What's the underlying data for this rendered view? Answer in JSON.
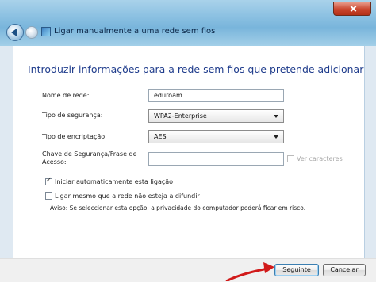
{
  "window": {
    "title": "Ligar manualmente a uma rede sem fios"
  },
  "content": {
    "heading": "Introduzir informações para a rede sem fios que pretende adicionar",
    "network_name": {
      "label": "Nome de rede:",
      "value": "eduroam"
    },
    "security_type": {
      "label": "Tipo de segurança:",
      "value": "WPA2-Enterprise"
    },
    "encryption_type": {
      "label": "Tipo de encriptação:",
      "value": "AES"
    },
    "security_key": {
      "label": "Chave de Segurança/Frase de Acesso:",
      "value": ""
    },
    "show_characters": {
      "label": "Ver caracteres",
      "checked": false,
      "enabled": false
    },
    "auto_start": {
      "label": "Iniciar automaticamente esta ligação",
      "checked": true
    },
    "connect_hidden": {
      "label": "Ligar mesmo que a rede não esteja a difundir",
      "checked": false
    },
    "warning_note": "Aviso: Se seleccionar esta opção, a privacidade do computador poderá ficar em risco."
  },
  "footer": {
    "next_label": "Seguinte",
    "cancel_label": "Cancelar"
  },
  "colors": {
    "heading": "#1f3c8c",
    "annotation_arrow": "#d11a1a",
    "titlebar": "#8cc1e2"
  },
  "icons": {
    "back": "back-arrow-icon",
    "forward": "forward-arrow-icon",
    "wizard": "wireless-network-icon",
    "close": "close-icon",
    "dropdown": "chevron-down-icon"
  }
}
